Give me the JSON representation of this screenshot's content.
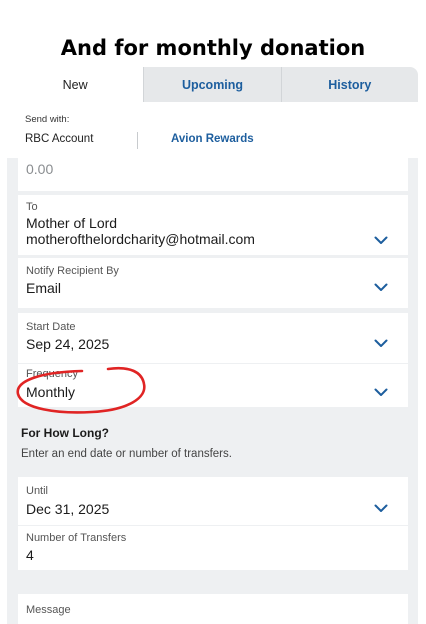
{
  "caption": "And for monthly donation",
  "tabs": [
    {
      "label": "New",
      "active": true
    },
    {
      "label": "Upcoming",
      "active": false
    },
    {
      "label": "History",
      "active": false
    }
  ],
  "send_with": {
    "label": "Send with:",
    "options": [
      "RBC Account",
      "Avion Rewards"
    ]
  },
  "amount": {
    "value": "0.00"
  },
  "to": {
    "label": "To",
    "name": "Mother of Lord",
    "email": "motherofthelordcharity@hotmail.com"
  },
  "notify": {
    "label": "Notify Recipient By",
    "value": "Email"
  },
  "start_date": {
    "label": "Start Date",
    "value": "Sep 24, 2025"
  },
  "frequency": {
    "label": "Frequency",
    "value": "Monthly"
  },
  "duration": {
    "title": "For How Long?",
    "subtitle": "Enter an end date or number of transfers."
  },
  "until": {
    "label": "Until",
    "value": "Dec 31, 2025"
  },
  "num_transfers": {
    "label": "Number of Transfers",
    "value": "4"
  },
  "message": {
    "label": "Message"
  },
  "colors": {
    "accent": "#1d5e9e",
    "background": "#eef0f2",
    "annotation": "#e02424"
  },
  "icons": [
    "chevron-down-icon"
  ]
}
